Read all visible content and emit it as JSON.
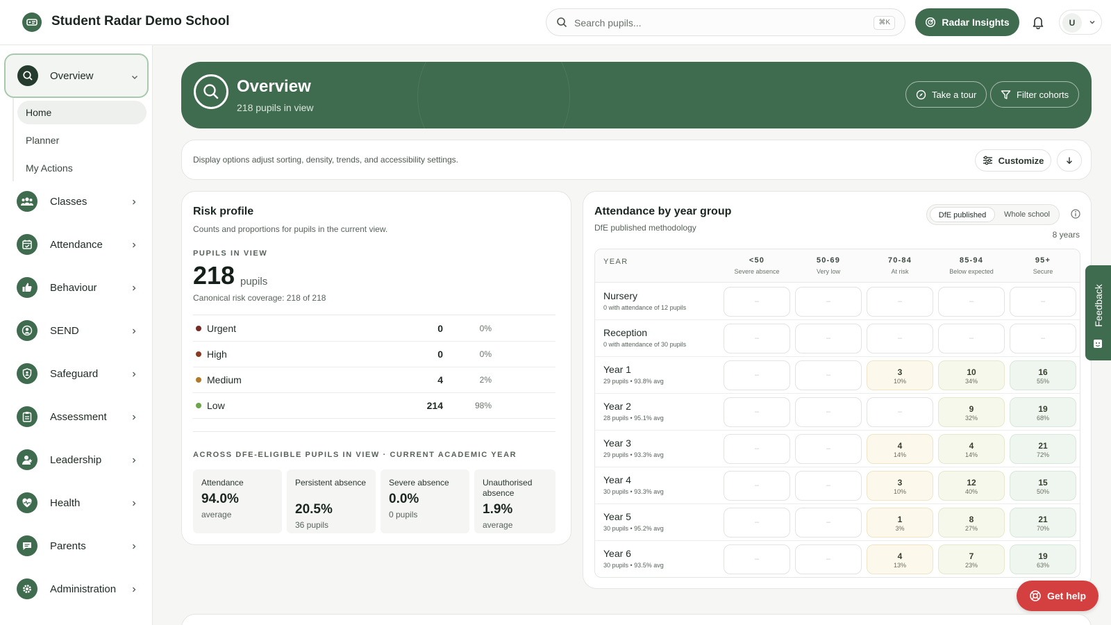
{
  "header": {
    "app_title": "Student Radar Demo School",
    "search_placeholder": "Search pupils...",
    "search_shortcut": "⌘K",
    "insights_label": "Radar Insights",
    "user_initial": "U"
  },
  "sidebar": {
    "overview_label": "Overview",
    "sub_items": [
      {
        "label": "Home",
        "active": true
      },
      {
        "label": "Planner",
        "active": false
      },
      {
        "label": "My Actions",
        "active": false
      }
    ],
    "items": [
      {
        "label": "Classes",
        "icon": "people-icon"
      },
      {
        "label": "Attendance",
        "icon": "calendar-check-icon"
      },
      {
        "label": "Behaviour",
        "icon": "thumbs-up-icon"
      },
      {
        "label": "SEND",
        "icon": "person-circle-icon"
      },
      {
        "label": "Safeguard",
        "icon": "shield-icon"
      },
      {
        "label": "Assessment",
        "icon": "clipboard-icon"
      },
      {
        "label": "Leadership",
        "icon": "leader-icon"
      },
      {
        "label": "Health",
        "icon": "heart-pulse-icon"
      },
      {
        "label": "Parents",
        "icon": "chat-icon"
      },
      {
        "label": "Administration",
        "icon": "gear-icon"
      }
    ]
  },
  "hero": {
    "title": "Overview",
    "subtitle": "218 pupils in view",
    "tour_label": "Take a tour",
    "filter_label": "Filter cohorts"
  },
  "display_bar": {
    "text": "Display options adjust sorting, density, trends, and accessibility settings.",
    "customize_label": "Customize"
  },
  "risk_profile": {
    "title": "Risk profile",
    "subtitle": "Counts and proportions for pupils in the current view.",
    "eyebrow": "PUPILS IN VIEW",
    "total": "218",
    "total_unit": "pupils",
    "coverage": "Canonical risk coverage: 218 of 218",
    "levels": [
      {
        "label": "Urgent",
        "count": "0",
        "pct": "0%",
        "color": "#7a2a25"
      },
      {
        "label": "High",
        "count": "0",
        "pct": "0%",
        "color": "#8a3a22"
      },
      {
        "label": "Medium",
        "count": "4",
        "pct": "2%",
        "color": "#b07a2a"
      },
      {
        "label": "Low",
        "count": "214",
        "pct": "98%",
        "color": "#6aa64a"
      }
    ],
    "eyebrow2": "ACROSS DFE-ELIGIBLE PUPILS IN VIEW · CURRENT ACADEMIC YEAR",
    "stats": [
      {
        "label": "Attendance",
        "value": "94.0%",
        "sub": "average"
      },
      {
        "label": "Persistent absence",
        "value": "20.5%",
        "sub": "36 pupils"
      },
      {
        "label": "Severe absence",
        "value": "0.0%",
        "sub": "0 pupils"
      },
      {
        "label": "Unauthorised absence",
        "value": "1.9%",
        "sub": "average"
      }
    ]
  },
  "attendance": {
    "title": "Attendance by year group",
    "subtitle": "DfE published methodology",
    "toggle_dfe": "DfE published",
    "toggle_whole": "Whole school",
    "years_label": "8 years",
    "year_header": "YEAR",
    "empty_glyph": "–",
    "bands": [
      {
        "band": "<50",
        "desc": "Severe absence"
      },
      {
        "band": "50-69",
        "desc": "Very low"
      },
      {
        "band": "70-84",
        "desc": "At risk"
      },
      {
        "band": "85-94",
        "desc": "Below expected"
      },
      {
        "band": "95+",
        "desc": "Secure"
      }
    ],
    "rows": [
      {
        "name": "Nursery",
        "sub": "0 with attendance of 12 pupils",
        "cells": [
          null,
          null,
          null,
          null,
          null
        ]
      },
      {
        "name": "Reception",
        "sub": "0 with attendance of 30 pupils",
        "cells": [
          null,
          null,
          null,
          null,
          null
        ]
      },
      {
        "name": "Year 1",
        "sub": "29 pupils • 93.8% avg",
        "cells": [
          null,
          null,
          {
            "n": "3",
            "p": "10%"
          },
          {
            "n": "10",
            "p": "34%"
          },
          {
            "n": "16",
            "p": "55%"
          }
        ]
      },
      {
        "name": "Year 2",
        "sub": "28 pupils • 95.1% avg",
        "cells": [
          null,
          null,
          null,
          {
            "n": "9",
            "p": "32%"
          },
          {
            "n": "19",
            "p": "68%"
          }
        ]
      },
      {
        "name": "Year 3",
        "sub": "29 pupils • 93.3% avg",
        "cells": [
          null,
          null,
          {
            "n": "4",
            "p": "14%"
          },
          {
            "n": "4",
            "p": "14%"
          },
          {
            "n": "21",
            "p": "72%"
          }
        ]
      },
      {
        "name": "Year 4",
        "sub": "30 pupils • 93.3% avg",
        "cells": [
          null,
          null,
          {
            "n": "3",
            "p": "10%"
          },
          {
            "n": "12",
            "p": "40%"
          },
          {
            "n": "15",
            "p": "50%"
          }
        ]
      },
      {
        "name": "Year 5",
        "sub": "30 pupils • 95.2% avg",
        "cells": [
          null,
          null,
          {
            "n": "1",
            "p": "3%"
          },
          {
            "n": "8",
            "p": "27%"
          },
          {
            "n": "21",
            "p": "70%"
          }
        ]
      },
      {
        "name": "Year 6",
        "sub": "30 pupils • 93.5% avg",
        "cells": [
          null,
          null,
          {
            "n": "4",
            "p": "13%"
          },
          {
            "n": "7",
            "p": "23%"
          },
          {
            "n": "19",
            "p": "63%"
          }
        ]
      }
    ]
  },
  "feedback_label": "Feedback",
  "help_label": "Get help",
  "colors": {
    "brand": "#3f6b4f",
    "help": "#d43f3f"
  }
}
